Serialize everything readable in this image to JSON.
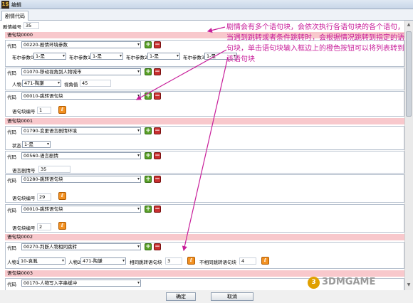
{
  "window": {
    "title": "编辑",
    "icon_letter": "1$"
  },
  "tabs": [
    {
      "label": "剧情代码"
    }
  ],
  "plot_id": {
    "label": "剧情编号",
    "value": "35"
  },
  "blocks": [
    {
      "header": "语句块0000",
      "statements": [
        {
          "code_label": "代码",
          "code_value": "00220-剧情环境参数",
          "params": [
            {
              "label": "布尔参数0",
              "value": "1-是"
            },
            {
              "label": "布尔参数1",
              "value": "1-是"
            },
            {
              "label": "布尔参数2",
              "value": "1-是"
            },
            {
              "label": "布尔参数3",
              "value": "1-是"
            }
          ]
        },
        {
          "code_label": "代码",
          "code_value": "01070-移动视角到人物城市",
          "params": [
            {
              "label": "人物",
              "value": "471-陶謙"
            },
            {
              "label": "视角值",
              "value": "45"
            }
          ]
        },
        {
          "code_label": "代码",
          "code_value": "00010-跳转语句块",
          "params": [
            {
              "label": "语句块编号",
              "value": "1"
            }
          ]
        }
      ]
    },
    {
      "header": "语句块0001",
      "statements": [
        {
          "code_label": "代码",
          "code_value": "01790-变更语言剧情环境",
          "params": [
            {
              "label": "状态",
              "value": "1-是"
            }
          ]
        },
        {
          "code_label": "代码",
          "code_value": "00560-语言剧情",
          "params": [
            {
              "label": "语言剧情号",
              "value": "35"
            }
          ]
        },
        {
          "code_label": "代码",
          "code_value": "01280-跳转语句块",
          "params": [
            {
              "label": "语句块编号",
              "value": "29"
            }
          ]
        },
        {
          "code_label": "代码",
          "code_value": "00010-跳转语句块",
          "params": [
            {
              "label": "语句块编号",
              "value": "2"
            }
          ]
        }
      ]
    },
    {
      "header": "语句块0002",
      "statements": [
        {
          "code_label": "代码",
          "code_value": "00270-判断人物相同跳转",
          "params": [
            {
              "label": "人物1",
              "value": "10-袁胤"
            },
            {
              "label": "人物2",
              "value": "471-陶謙"
            },
            {
              "label": "相同跳转语句块",
              "value": "3"
            },
            {
              "label": "不相同跳转语句块",
              "value": "4"
            }
          ]
        }
      ]
    },
    {
      "header": "语句块0003",
      "statements": [
        {
          "code_label": "代码",
          "code_value": "00170-人物写入字串缓冲"
        }
      ]
    }
  ],
  "buttons": {
    "ok": "确定",
    "cancel": "取消"
  },
  "icons": {
    "plus": "+",
    "minus": "−",
    "jump": "ℓ"
  },
  "annotation": "剧情会有多个语句块，会依次执行各语句块的各个语句，当遇到跳转或者条件跳转时，会根据情况跳转到指定的语句块，单击语句块输入框边上的橙色按钮可以将列表转到该语句块",
  "watermark": "3DMGAME",
  "watermark_badge": "3",
  "colors": {
    "block_header": "#f8c8cc",
    "annotation": "#c81e9a",
    "add": "#5aa028",
    "remove": "#c83030",
    "jump": "#f29020"
  }
}
